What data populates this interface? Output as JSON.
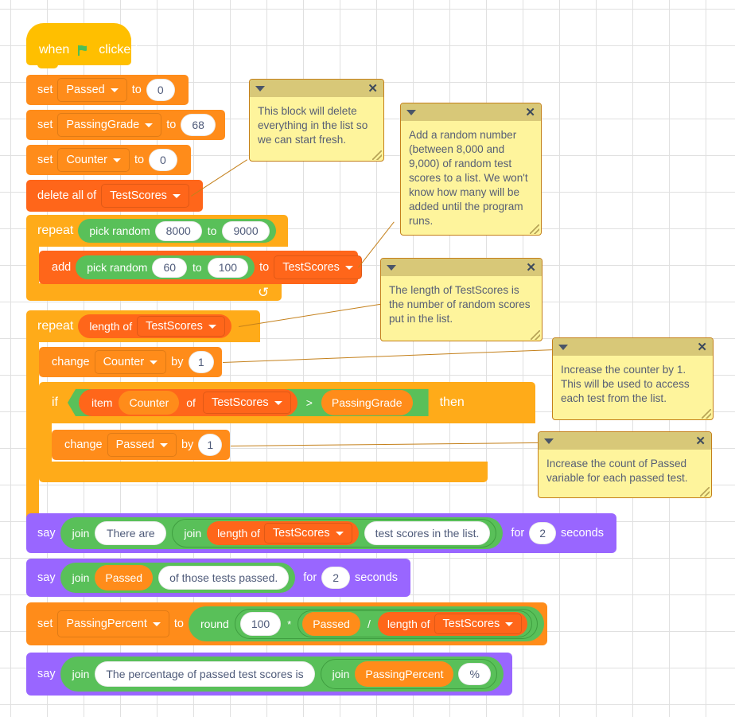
{
  "app": {
    "name": "Scratch Block Editor Workspace",
    "canvas_background": "#ffffff"
  },
  "palette": {
    "events": "#FFBF00",
    "variables": "#FF8C1A",
    "lists": "#FF661A",
    "control": "#FFAB19",
    "looks": "#9966FF",
    "operators": "#59C059",
    "comment_body": "#FEF49C",
    "comment_header": "#D8C878",
    "comment_border": "#C4801B",
    "comment_text": "#575E75",
    "input_text": "#4f5b7a"
  },
  "script": {
    "hat": {
      "word_when": "when",
      "icon": "green-flag-icon",
      "word_clicked": "clicked"
    },
    "set_passed": {
      "op": "set",
      "variable": "Passed",
      "to": "to",
      "value": "0"
    },
    "set_passinggrade": {
      "op": "set",
      "variable": "PassingGrade",
      "to": "to",
      "value": "68"
    },
    "set_counter": {
      "op": "set",
      "variable": "Counter",
      "to": "to",
      "value": "0"
    },
    "delete_all": {
      "op": "delete all of",
      "list": "TestScores"
    },
    "repeat_outer": {
      "op": "repeat",
      "pick_random": "pick random",
      "from": "8000",
      "to_word": "to",
      "to": "9000"
    },
    "add_to_list": {
      "op": "add",
      "pick_random": "pick random",
      "from": "60",
      "to_word": "to",
      "to": "100",
      "to_word2": "to",
      "list": "TestScores"
    },
    "repeat_inner": {
      "op": "repeat",
      "length_of": "length of",
      "list": "TestScores"
    },
    "change_counter": {
      "op": "change",
      "variable": "Counter",
      "by": "by",
      "value": "1"
    },
    "if_block": {
      "op": "if",
      "item": "item",
      "index_var": "Counter",
      "of": "of",
      "list": "TestScores",
      "operator": ">",
      "compare_var": "PassingGrade",
      "then": "then"
    },
    "change_passed": {
      "op": "change",
      "variable": "Passed",
      "by": "by",
      "value": "1"
    },
    "say_count": {
      "op": "say",
      "join1": "join",
      "text1": "There are",
      "join2": "join",
      "length_of": "length of",
      "list": "TestScores",
      "text2": "test scores in the list.",
      "for": "for",
      "seconds_value": "2",
      "seconds": "seconds"
    },
    "say_passed": {
      "op": "say",
      "join1": "join",
      "variable": "Passed",
      "text1": "of those tests passed.",
      "for": "for",
      "seconds_value": "2",
      "seconds": "seconds"
    },
    "set_percent": {
      "op": "set",
      "variable": "PassingPercent",
      "to": "to",
      "round": "round",
      "hundred": "100",
      "multiply": "*",
      "passed_var": "Passed",
      "divide": "/",
      "length_of": "length of",
      "list": "TestScores"
    },
    "say_percent": {
      "op": "say",
      "join1": "join",
      "text1": "The percentage of passed test scores is",
      "join2": "join",
      "variable": "PassingPercent",
      "percent": "%"
    }
  },
  "comments": [
    {
      "id": "comment-delete-all",
      "text": "This block will delete everything in the list so we can start fresh."
    },
    {
      "id": "comment-add-random",
      "text": "Add a random number (between 8,000 and 9,000) of random test scores to a list. We won't know how many will be added until the program runs."
    },
    {
      "id": "comment-length",
      "text": "The length of TestScores is the number of random scores put in the list."
    },
    {
      "id": "comment-counter",
      "text": "Increase the counter by 1. This will be used to access each test from the list."
    },
    {
      "id": "comment-passed",
      "text": "Increase the count of Passed variable for each passed test."
    }
  ]
}
